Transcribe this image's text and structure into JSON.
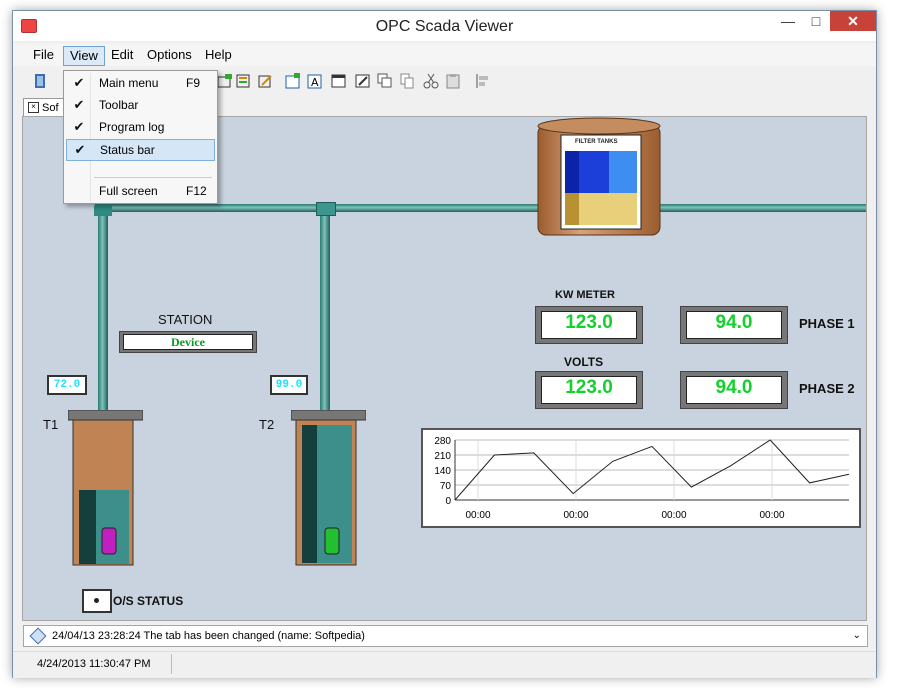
{
  "window": {
    "title": "OPC Scada Viewer"
  },
  "menubar": {
    "items": [
      "File",
      "View",
      "Edit",
      "Options",
      "Help"
    ],
    "active": "View"
  },
  "view_menu": {
    "items": [
      {
        "label": "Main menu",
        "shortcut": "F9",
        "checked": true
      },
      {
        "label": "Toolbar",
        "shortcut": "",
        "checked": true
      },
      {
        "label": "Program log",
        "shortcut": "",
        "checked": true
      },
      {
        "label": "Status bar",
        "shortcut": "",
        "checked": true,
        "highlighted": true
      },
      {
        "label": "Full screen",
        "shortcut": "F12",
        "checked": false
      }
    ],
    "check_glyph": "✔"
  },
  "tab": {
    "label": "Sof"
  },
  "scada": {
    "filter_label": "FILTER TANKS",
    "station_label": "STATION",
    "device_label": "Device",
    "tank1": {
      "name": "T1",
      "value": "72.0"
    },
    "tank2": {
      "name": "T2",
      "value": "99.0"
    },
    "kw_meter_label": "KW METER",
    "volts_label": "VOLTS",
    "kw_value": "123.0",
    "kw_phase_value": "94.0",
    "volts_value": "123.0",
    "volts_phase_value": "94.0",
    "phase1_label": "PHASE 1",
    "phase2_label": "PHASE 2",
    "os_status_label": "O/S STATUS"
  },
  "chart_data": {
    "type": "line",
    "title": "",
    "xlabel": "",
    "ylabel": "",
    "yticks": [
      280,
      210,
      140,
      70,
      0
    ],
    "ylim": [
      0,
      280
    ],
    "xticks": [
      "00:00",
      "00:00",
      "00:00",
      "00:00"
    ],
    "series": [
      {
        "values": [
          0,
          210,
          220,
          30,
          180,
          250,
          60,
          160,
          280,
          80,
          120
        ]
      }
    ],
    "grid": true
  },
  "log": {
    "text": "24/04/13 23:28:24 The tab has been changed (name: Softpedia)"
  },
  "statusbar": {
    "text": "4/24/2013 11:30:47 PM"
  },
  "colors": {
    "pipe": "#2f8a83",
    "value_green": "#13d12b",
    "tank_fill": "#3c8f8a",
    "canvas_bg": "#c9d3df"
  }
}
